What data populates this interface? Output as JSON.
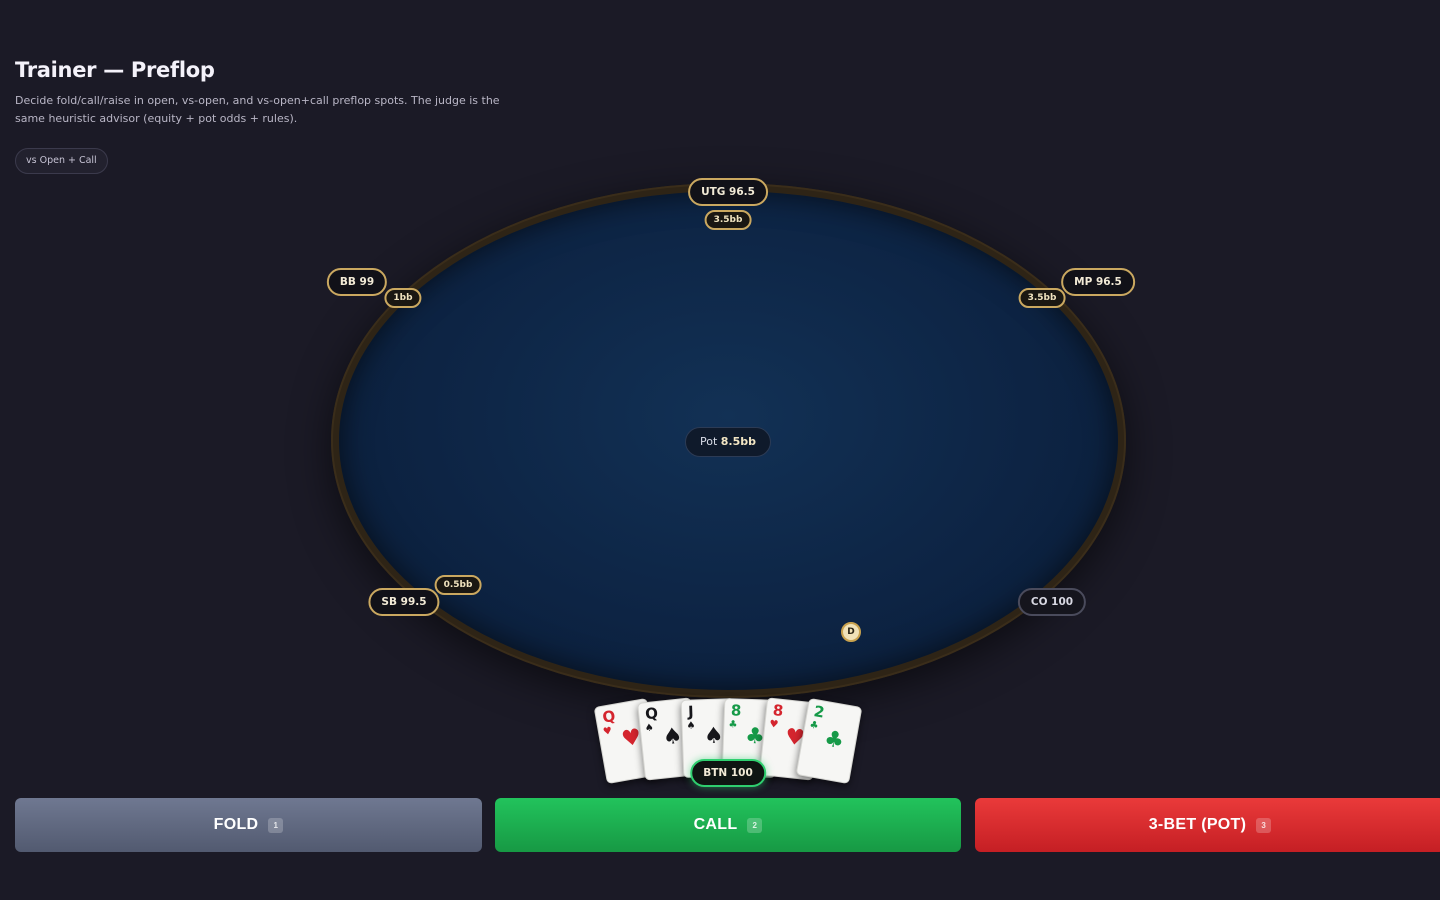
{
  "header": {
    "title": "Trainer — Preflop",
    "description": "Decide fold/call/raise in open, vs-open, and vs-open+call preflop spots. The judge is the same heuristic advisor (equity + pot odds + rules)."
  },
  "mode": {
    "label": "vs Open + Call"
  },
  "table": {
    "pot_label": "Pot",
    "pot_value": "8.5bb",
    "dealer_button": "D",
    "seats": {
      "utg": {
        "label": "UTG 96.5",
        "bet": "3.5bb"
      },
      "mp": {
        "label": "MP 96.5",
        "bet": "3.5bb"
      },
      "co": {
        "label": "CO 100"
      },
      "btn": {
        "label": "BTN 100"
      },
      "sb": {
        "label": "SB 99.5",
        "bet": "0.5bb"
      },
      "bb": {
        "label": "BB 99",
        "bet": "1bb"
      }
    }
  },
  "hand": {
    "cards": [
      {
        "rank": "Q",
        "suit": "♥",
        "color": "#d4252e"
      },
      {
        "rank": "Q",
        "suit": "♠",
        "color": "#16161a"
      },
      {
        "rank": "J",
        "suit": "♠",
        "color": "#16161a"
      },
      {
        "rank": "8",
        "suit": "♣",
        "color": "#169a48"
      },
      {
        "rank": "8",
        "suit": "♥",
        "color": "#d4252e"
      },
      {
        "rank": "2",
        "suit": "♣",
        "color": "#169a48"
      }
    ]
  },
  "actions": {
    "fold": {
      "label": "FOLD",
      "key": "1",
      "color": "#5f6780"
    },
    "call": {
      "label": "CALL",
      "key": "2",
      "color": "#1fb052"
    },
    "raise": {
      "label": "3-BET (POT)",
      "key": "3",
      "color": "#d92b2e"
    }
  }
}
